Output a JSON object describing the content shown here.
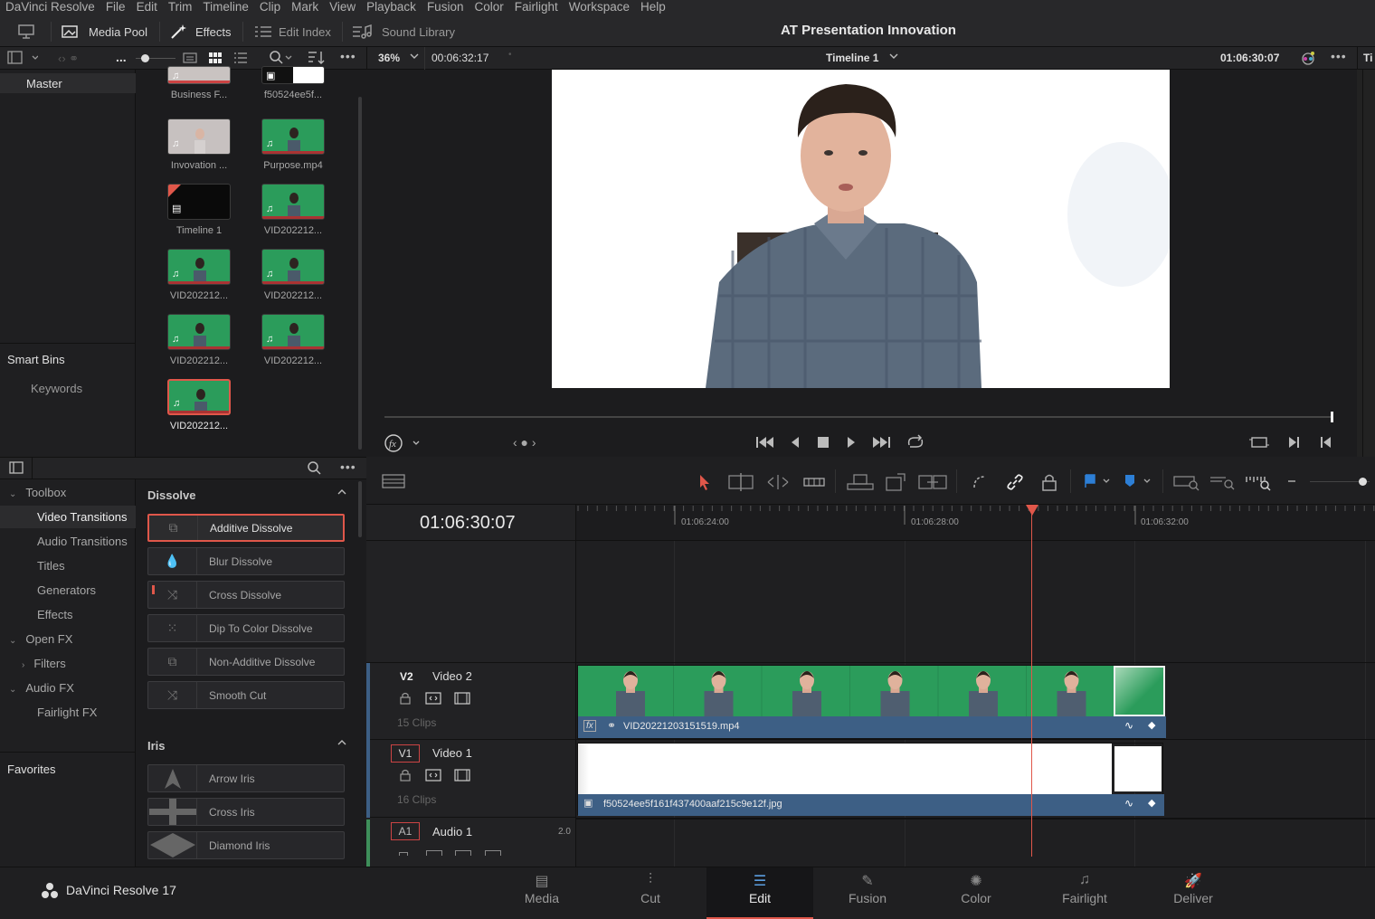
{
  "menu": [
    "DaVinci Resolve",
    "File",
    "Edit",
    "Trim",
    "Timeline",
    "Clip",
    "Mark",
    "View",
    "Playback",
    "Fusion",
    "Color",
    "Fairlight",
    "Workspace",
    "Help"
  ],
  "toolbar": {
    "media_pool": "Media Pool",
    "effects": "Effects",
    "edit_index": "Edit Index",
    "sound_library": "Sound Library",
    "project_title": "AT Presentation Innovation"
  },
  "row2": {
    "more": "...",
    "zoom": "36%",
    "timecode_left": "00:06:32:17",
    "timeline_name": "Timeline 1",
    "timecode_right": "01:06:30:07",
    "right_cut": "Ti"
  },
  "bins": {
    "master": "Master",
    "smart_bins": "Smart Bins",
    "keywords": "Keywords"
  },
  "clips": [
    {
      "name": "Business F..."
    },
    {
      "name": "f50524ee5f..."
    },
    {
      "name": "Invovation ..."
    },
    {
      "name": "Purpose.mp4"
    },
    {
      "name": "Timeline 1"
    },
    {
      "name": "VID202212..."
    },
    {
      "name": "VID202212..."
    },
    {
      "name": "VID202212..."
    },
    {
      "name": "VID202212..."
    },
    {
      "name": "VID202212..."
    },
    {
      "name": "VID202212..."
    }
  ],
  "fx_tree": {
    "toolbox": "Toolbox",
    "video_transitions": "Video Transitions",
    "audio_transitions": "Audio Transitions",
    "titles": "Titles",
    "generators": "Generators",
    "effects": "Effects",
    "open_fx": "Open FX",
    "filters": "Filters",
    "audio_fx": "Audio FX",
    "fairlight_fx": "Fairlight FX",
    "favorites": "Favorites"
  },
  "fx_groups": {
    "dissolve": "Dissolve",
    "iris": "Iris"
  },
  "dissolves": [
    "Additive Dissolve",
    "Blur Dissolve",
    "Cross Dissolve",
    "Dip To Color Dissolve",
    "Non-Additive Dissolve",
    "Smooth Cut"
  ],
  "irises": [
    "Arrow Iris",
    "Cross Iris",
    "Diamond Iris"
  ],
  "timeline": {
    "current_tc": "01:06:30:07",
    "ruler": [
      "01:06:24:00",
      "01:06:28:00",
      "01:06:32:00"
    ],
    "tracks": {
      "v2_badge": "V2",
      "v2_name": "Video 2",
      "v2_clips": "15 Clips",
      "v2_clip_name": "VID20221203151519.mp4",
      "v1_badge": "V1",
      "v1_name": "Video 1",
      "v1_clips": "16 Clips",
      "v1_clip_name": "f50524ee5f161f437400aaf215c9e12f.jpg",
      "a1_badge": "A1",
      "a1_name": "Audio 1",
      "a1_ch": "2.0"
    }
  },
  "footer": {
    "app": "DaVinci Resolve 17",
    "pages": [
      "Media",
      "Cut",
      "Edit",
      "Fusion",
      "Color",
      "Fairlight",
      "Deliver"
    ],
    "active_page": "Edit"
  },
  "colors": {
    "accent": "#e0574a",
    "clip_green": "#2b9c5b",
    "clip_bar": "#3d5f85"
  }
}
